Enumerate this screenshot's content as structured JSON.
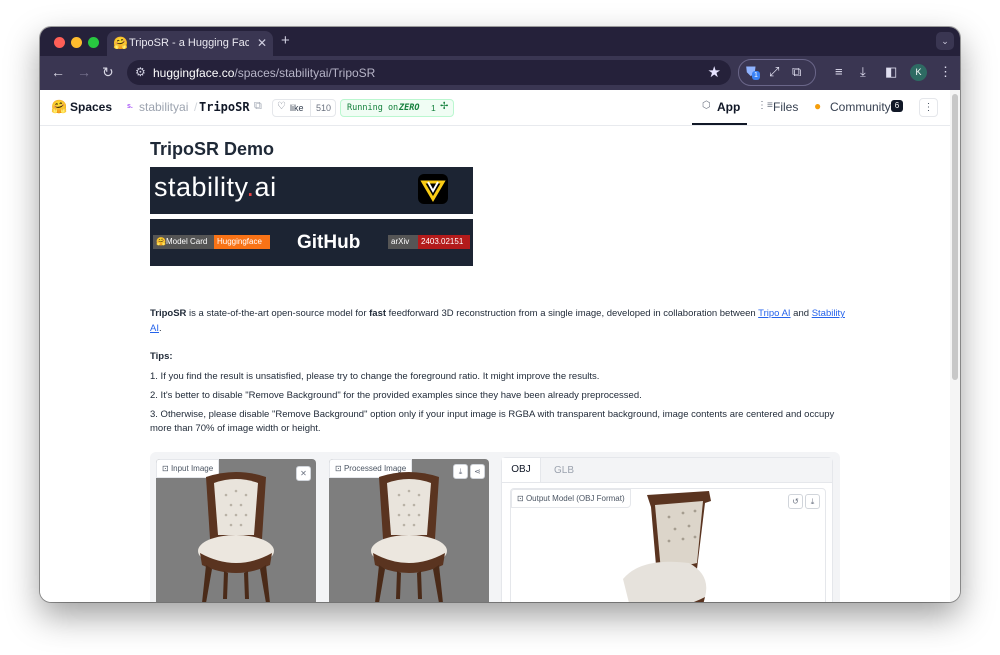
{
  "browser": {
    "tab_title": "TripoSR - a Hugging Face Spa",
    "tab_favicon": "🤗",
    "url_host": "huggingface.co",
    "url_path": "/spaces/stabilityai/TripoSR",
    "profile_initial": "K",
    "new_tab": "+",
    "tab_close": "✕",
    "ext_badge": "1"
  },
  "hf": {
    "logo": "🤗",
    "spaces": "Spaces",
    "owner": "stabilityai",
    "owner_avatar": "s.",
    "separator": "/",
    "repo": "TripoSR",
    "like_label": "like",
    "like_count": "510",
    "running_label": "Running on",
    "running_hw": "ZERO",
    "replicas": "1",
    "tabs": [
      {
        "label": "App",
        "icon": "⬡"
      },
      {
        "label": "Files",
        "icon": "⋮≡"
      },
      {
        "label": "Community",
        "icon": "●",
        "badge": "6"
      }
    ]
  },
  "demo": {
    "title": "TripoSR Demo",
    "banner1_text": "stability",
    "banner1_dot": ".",
    "banner1_tail": "ai",
    "model_card_label": "🤗Model Card",
    "model_card_value": "Huggingface",
    "github": "GitHub",
    "arxiv_label": "arXiv",
    "arxiv_value": "2403.02151",
    "intro_bold": "TripoSR",
    "intro_1": " is a state-of-the-art open-source model for ",
    "intro_fast": "fast",
    "intro_2": " feedforward 3D reconstruction from a single image, developed in collaboration between ",
    "link_tripo": "Tripo AI",
    "intro_and": " and ",
    "link_stability_1": "Stability",
    "link_stability_2": "AI",
    "intro_end": ".",
    "tips_title": "Tips:",
    "tips": [
      "1. If you find the result is unsatisfied, please try to change the foreground ratio. It might improve the results.",
      "2. It's better to disable \"Remove Background\" for the provided examples since they have been already preprocessed.",
      "3. Otherwise, please disable \"Remove Background\" option only if your input image is RGBA with transparent background, image contents are centered and occupy",
      "more than 70% of image width or height."
    ]
  },
  "app": {
    "input_label": "Input Image",
    "processed_label": "Processed Image",
    "tab_obj": "OBJ",
    "tab_glb": "GLB",
    "output_label": "Output Model (OBJ Format)",
    "close_icon": "✕"
  },
  "colors": {
    "chrome_dark": "#25213a",
    "chrome_mid": "#3a3652",
    "banner": "#1c2433",
    "huggingface_orange": "#f97316",
    "arxiv_red": "#b31b1b",
    "link": "#2563eb",
    "running_green": "#16a34a"
  }
}
